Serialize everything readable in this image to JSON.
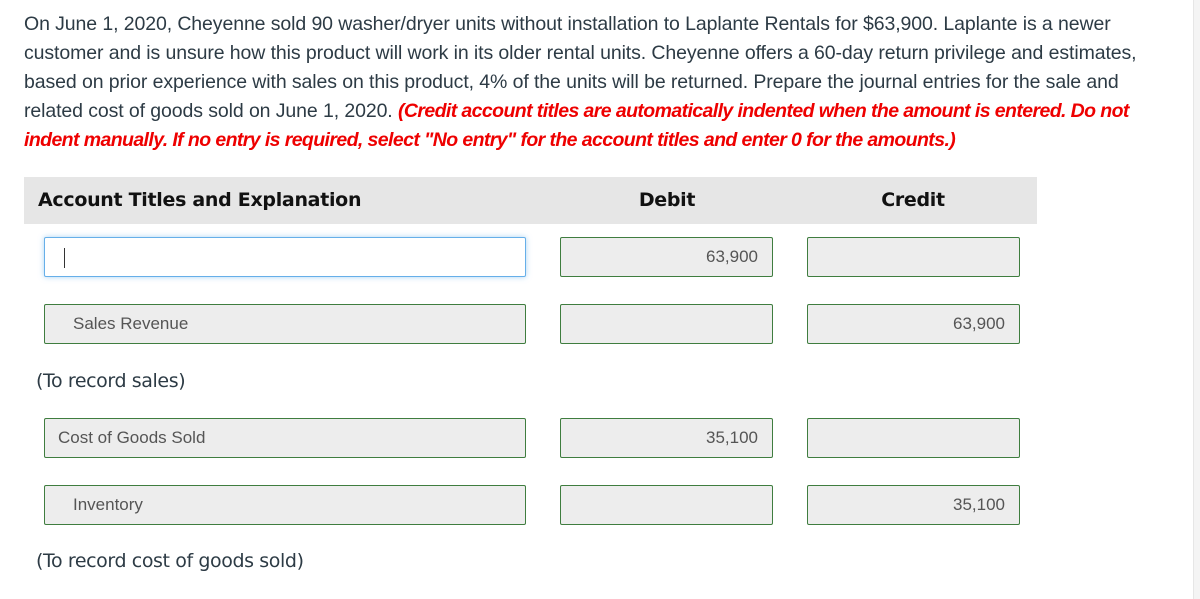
{
  "question": {
    "body": "On June 1, 2020, Cheyenne sold 90 washer/dryer units without installation to Laplante Rentals for $63,900. Laplante is a newer customer and is unsure how this product will work in its older rental units. Cheyenne offers a 60-day return privilege and estimates, based on prior experience with sales on this product, 4% of the units will be returned. Prepare the journal entries for the sale and related cost of goods sold on June 1, 2020.",
    "instructions": "(Credit account titles are automatically indented when the amount is entered. Do not indent manually. If no entry is required, select \"No entry\" for the account titles and enter 0 for the amounts.)"
  },
  "table": {
    "headers": {
      "account": "Account Titles and Explanation",
      "debit": "Debit",
      "credit": "Credit"
    },
    "entries": [
      {
        "lines": [
          {
            "account": "",
            "debit": "63,900",
            "credit": "",
            "focused": true
          },
          {
            "account": "Sales Revenue",
            "debit": "",
            "credit": "63,900"
          }
        ],
        "explanation": "(To record sales)"
      },
      {
        "lines": [
          {
            "account": "Cost of Goods Sold",
            "debit": "35,100",
            "credit": ""
          },
          {
            "account": "Inventory",
            "debit": "",
            "credit": "35,100"
          }
        ],
        "explanation": "(To record cost of goods sold)"
      }
    ]
  },
  "colors": {
    "instruction_red": "#ee0000",
    "field_border": "#3f7d3f",
    "focus_border": "#66afe9",
    "header_bg": "#e6e6e6"
  }
}
